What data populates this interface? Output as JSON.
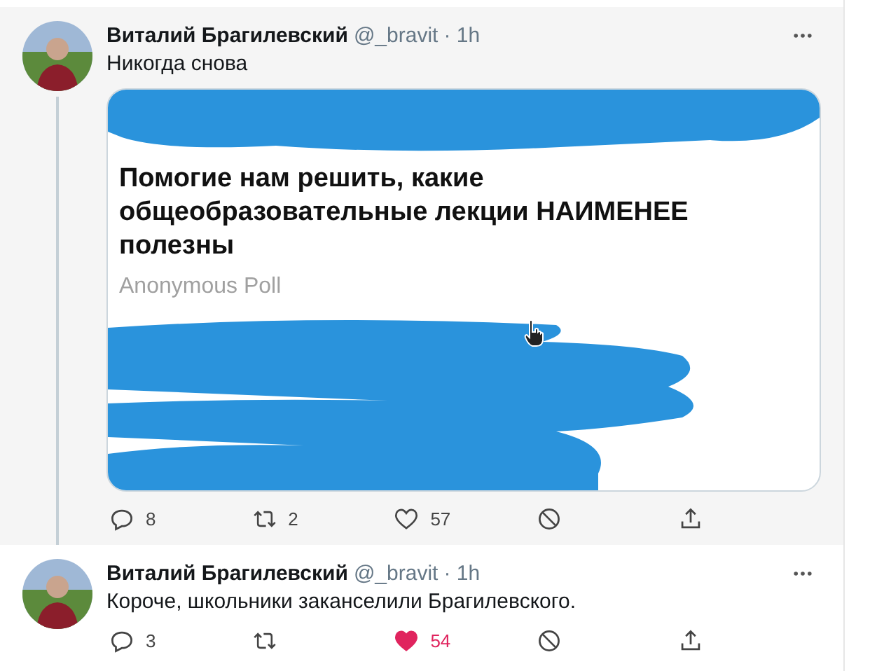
{
  "tweets": [
    {
      "author": "Виталий Брагилевский",
      "handle": "@_bravit",
      "time": "· 1h",
      "text": "Никогда снова",
      "highlighted": true,
      "thread_line": true,
      "media": {
        "kind": "screenshot",
        "heading": "Помогие нам решить, какие общеобразовательные лекции НАИМЕНЕЕ полезны",
        "subtitle": "Anonymous Poll"
      },
      "actions": {
        "replies": "8",
        "retweets": "2",
        "likes": "57",
        "liked": false
      }
    },
    {
      "author": "Виталий Брагилевский",
      "handle": "@_bravit",
      "time": "· 1h",
      "text": "Короче, школьники заканселили Брагилевского.",
      "highlighted": false,
      "thread_line": false,
      "actions": {
        "replies": "3",
        "likes": "54",
        "liked": true
      }
    }
  ]
}
